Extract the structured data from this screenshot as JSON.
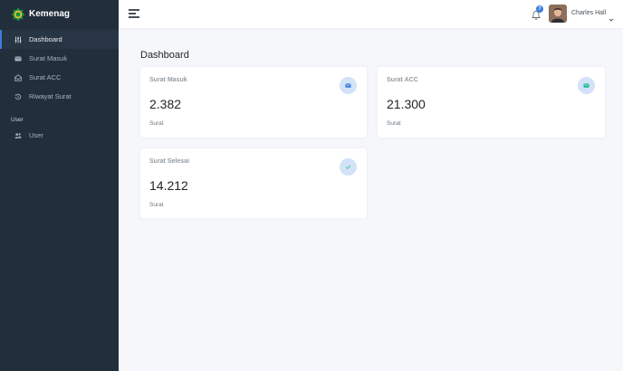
{
  "sidebar": {
    "brand": "Kemenag",
    "items": [
      {
        "label": "Dashboard",
        "icon": "sliders-icon"
      },
      {
        "label": "Surat Masuk",
        "icon": "envelope-icon"
      },
      {
        "label": "Surat ACC",
        "icon": "envelope-open-icon"
      },
      {
        "label": "Riwayat Surat",
        "icon": "history-icon"
      }
    ],
    "section_header": "User",
    "user_items": [
      {
        "label": "User",
        "icon": "users-icon"
      }
    ]
  },
  "topbar": {
    "notification_count": "7",
    "user_name": "Charles Hall"
  },
  "main": {
    "title": "Dashboard",
    "cards": [
      {
        "title": "Surat Masuk",
        "value": "2.382",
        "unit": "Surat",
        "icon": "envelope-icon",
        "icon_color": "#3b7ddd"
      },
      {
        "title": "Surat ACC",
        "value": "21.300",
        "unit": "Surat",
        "icon": "envelope-icon",
        "icon_color": "#1cbb8c"
      },
      {
        "title": "Surat Selesai",
        "value": "14.212",
        "unit": "Surat",
        "icon": "check-icon",
        "icon_color": "#1cbb8c"
      }
    ]
  },
  "colors": {
    "sidebar_bg": "#222e3c",
    "accent": "#3b7ddd",
    "page_bg": "#f5f7fb"
  }
}
